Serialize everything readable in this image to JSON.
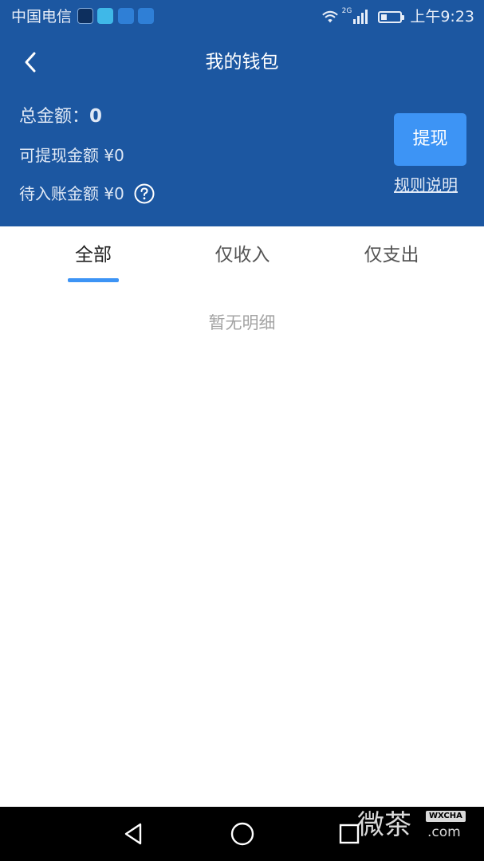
{
  "status_bar": {
    "carrier": "中国电信",
    "network": "2G",
    "time": "上午9:23",
    "battery_level": 0.3
  },
  "header": {
    "title": "我的钱包",
    "background_color": "#1c57a1"
  },
  "wallet": {
    "total_label": "总金额：",
    "total_amount": "0",
    "withdrawable_text": "可提现金额 ¥0",
    "pending_text": "待入账金额 ¥0",
    "withdraw_button": "提现",
    "withdraw_button_color": "#3d94f5",
    "rules_link": "规则说明"
  },
  "tabs": [
    {
      "label": "全部",
      "selected": true
    },
    {
      "label": "仅收入",
      "selected": false
    },
    {
      "label": "仅支出",
      "selected": false
    }
  ],
  "empty_state": "暂无明细",
  "watermark": {
    "main": "微茶",
    "tag": "WXCHA",
    "suffix": ".com"
  },
  "icons": {
    "back": "chevron-left-icon",
    "help": "question-circle-icon",
    "nav_back": "triangle-back-icon",
    "nav_home": "circle-home-icon",
    "nav_recents": "square-recents-icon"
  }
}
